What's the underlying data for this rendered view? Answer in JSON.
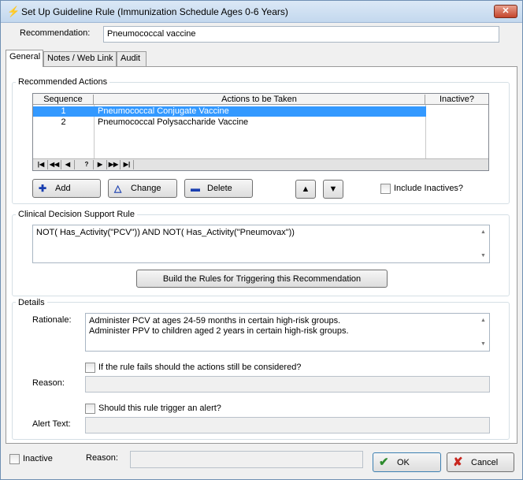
{
  "window": {
    "title": "Set Up Guideline Rule (Immunization Schedule Ages 0-6 Years)",
    "close_label": "✕"
  },
  "recommendation": {
    "label": "Recommendation:",
    "value": "Pneumococcal vaccine"
  },
  "tabs": [
    {
      "label": "General"
    },
    {
      "label": "Notes / Web Link"
    },
    {
      "label": "Audit"
    }
  ],
  "actions": {
    "group_title": "Recommended Actions",
    "columns": [
      "Sequence",
      "Actions to be Taken",
      "Inactive?"
    ],
    "rows": [
      {
        "sequence": "1",
        "action": "Pneumococcal Conjugate Vaccine"
      },
      {
        "sequence": "2",
        "action": "Pneumococcal Polysaccharide Vaccine"
      }
    ],
    "nav": [
      "|◀",
      "◀◀",
      "◀",
      "?",
      "▶",
      "▶▶",
      "▶|"
    ],
    "add_label": "Add",
    "change_label": "Change",
    "delete_label": "Delete",
    "include_inactives_label": "Include Inactives?"
  },
  "cds": {
    "group_title": "Clinical Decision Support Rule",
    "rule": "NOT( Has_Activity(\"PCV\")) AND NOT( Has_Activity(\"Pneumovax\"))",
    "build_label": "Build the Rules for Triggering this Recommendation"
  },
  "details": {
    "group_title": "Details",
    "rationale_label": "Rationale:",
    "rationale_line1": "Administer PCV at ages 24-59 months in certain high-risk groups.",
    "rationale_line2": "Administer PPV to children aged 2 years in certain high-risk groups.",
    "rule_fails_label": "If the rule fails should the actions still be considered?",
    "reason_label": "Reason:",
    "trigger_alert_label": "Should this rule trigger an alert?",
    "alert_text_label": "Alert Text:"
  },
  "footer": {
    "inactive_label": "Inactive",
    "reason_label": "Reason:",
    "ok_label": "OK",
    "cancel_label": "Cancel"
  }
}
